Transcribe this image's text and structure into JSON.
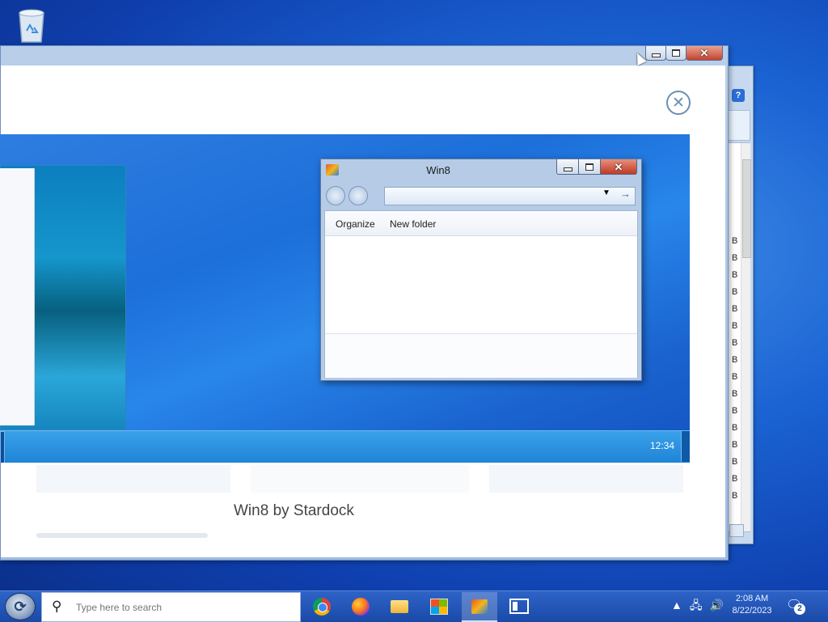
{
  "desktop": {
    "recycle_icon": "recycle-bin-icon"
  },
  "background_window": {
    "help_label": "?",
    "rows": [
      "B",
      "B",
      "B",
      "B",
      "B",
      "B",
      "B",
      "B",
      "B",
      "B",
      "B",
      "B",
      "B",
      "B",
      "B",
      "B"
    ]
  },
  "dialog": {
    "close_label": "✕",
    "caption": "Win8 by Stardock"
  },
  "preview": {
    "clock": "12:34",
    "explorer": {
      "title": "Win8",
      "organize": "Organize",
      "new_folder": "New folder"
    }
  },
  "taskbar": {
    "search_placeholder": "Type here to search",
    "apps": [
      "chrome-icon",
      "firefox-icon",
      "file-explorer-icon",
      "microsoft-store-icon",
      "win8-app-icon",
      "task-view-icon"
    ],
    "clock_time": "2:08 AM",
    "clock_date": "8/22/2023",
    "notification_count": "2"
  },
  "colors": {
    "accent": "#1a4aa8",
    "desktop": "#1b63d3",
    "close_red": "#c4432d"
  }
}
